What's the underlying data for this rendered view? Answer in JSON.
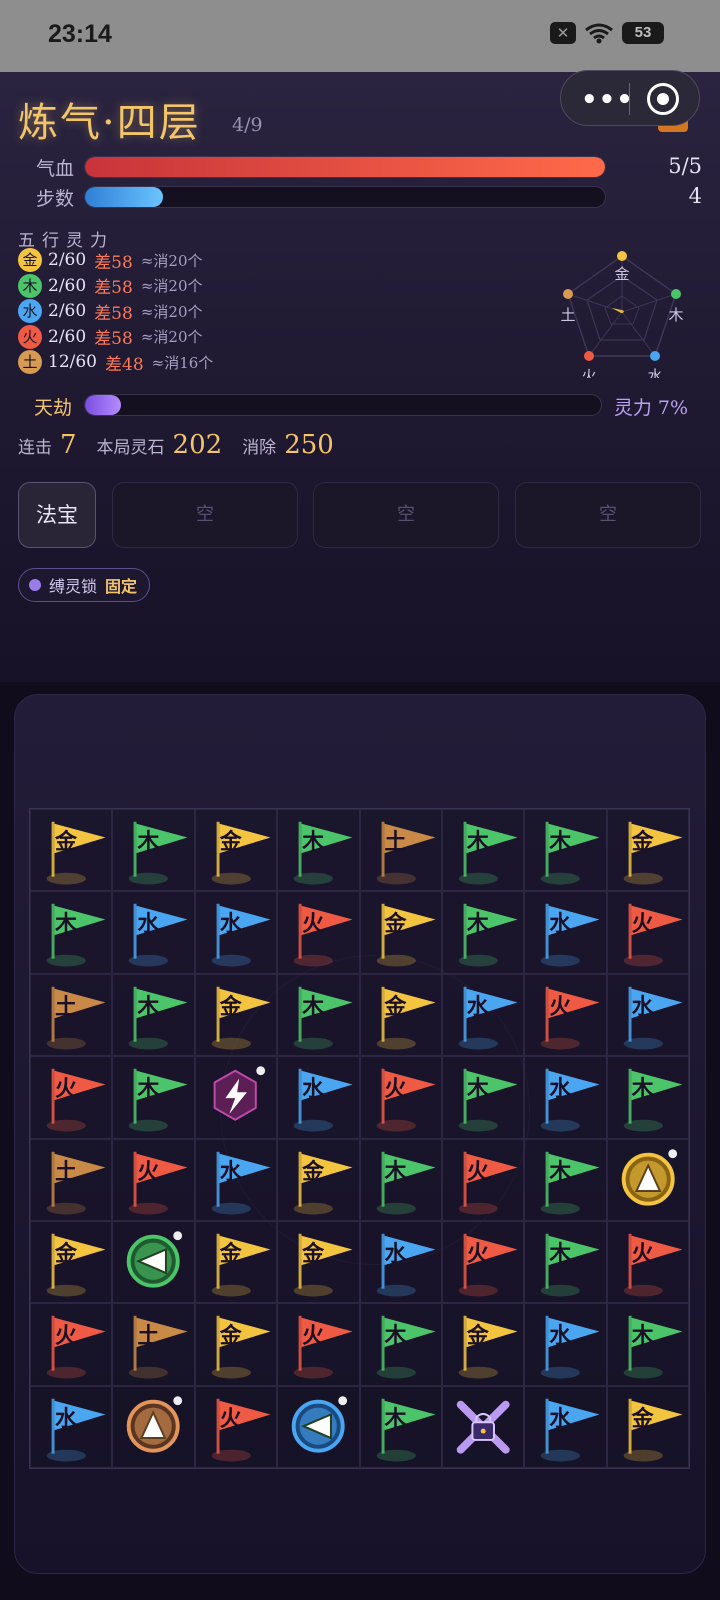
{
  "status_bar": {
    "time": "23:14",
    "battery": "53"
  },
  "header": {
    "title": "炼气·四层",
    "stage_count": "4/9"
  },
  "bars": {
    "hp": {
      "label": "气血",
      "value": "5/5",
      "fraction": 1.0,
      "color": "#e64a3a"
    },
    "steps": {
      "label": "步数",
      "value": "4",
      "fraction": 0.15,
      "color": "#3a9ff0"
    }
  },
  "elements": {
    "title": "五行灵力",
    "items": [
      {
        "glyph": "金",
        "value": "2/60",
        "gap": "差58",
        "need": "≈消20个",
        "color": "#f2c440"
      },
      {
        "glyph": "木",
        "value": "2/60",
        "gap": "差58",
        "need": "≈消20个",
        "color": "#4cc56a"
      },
      {
        "glyph": "水",
        "value": "2/60",
        "gap": "差58",
        "need": "≈消20个",
        "color": "#4aa6f0"
      },
      {
        "glyph": "火",
        "value": "2/60",
        "gap": "差58",
        "need": "≈消20个",
        "color": "#ef5a44"
      },
      {
        "glyph": "土",
        "value": "12/60",
        "gap": "差48",
        "need": "≈消16个",
        "color": "#d69a52"
      }
    ]
  },
  "radar": {
    "labels": [
      "金",
      "木",
      "水",
      "火",
      "土"
    ]
  },
  "tribulation": {
    "label": "天劫",
    "fraction": 0.07,
    "power_text": "灵力 7%"
  },
  "stats": {
    "combo_label": "连击",
    "combo": "7",
    "stones_label": "本局灵石",
    "stones": "202",
    "cleared_label": "消除",
    "cleared": "250"
  },
  "fabao": {
    "button": "法宝",
    "slots": [
      "空",
      "空",
      "空"
    ]
  },
  "status_tag": {
    "name": "缚灵锁",
    "state": "固定"
  },
  "board": {
    "colors": {
      "金": "#f2c440",
      "木": "#4cc56a",
      "水": "#4aa6f0",
      "火": "#ef5a44",
      "土": "#c98a48"
    },
    "rows": [
      [
        "金",
        "木",
        "金",
        "木",
        "土",
        "木",
        "木",
        "金"
      ],
      [
        "木",
        "水",
        "水",
        "火",
        "金",
        "木",
        "水",
        "火"
      ],
      [
        "土",
        "木",
        "金",
        "木",
        "金",
        "水",
        "火",
        "水"
      ],
      [
        "火",
        "木",
        "special:lightning",
        "水",
        "火",
        "木",
        "水",
        "木"
      ],
      [
        "土",
        "火",
        "水",
        "金",
        "木",
        "火",
        "木",
        "special:arrow-up-gold"
      ],
      [
        "金",
        "special:arrow-left-green",
        "金",
        "金",
        "水",
        "火",
        "木",
        "火"
      ],
      [
        "火",
        "土",
        "金",
        "火",
        "木",
        "金",
        "水",
        "木"
      ],
      [
        "水",
        "special:arrow-up-earth",
        "火",
        "special:arrow-left-blue",
        "木",
        "special:lock",
        "水",
        "金"
      ]
    ]
  }
}
